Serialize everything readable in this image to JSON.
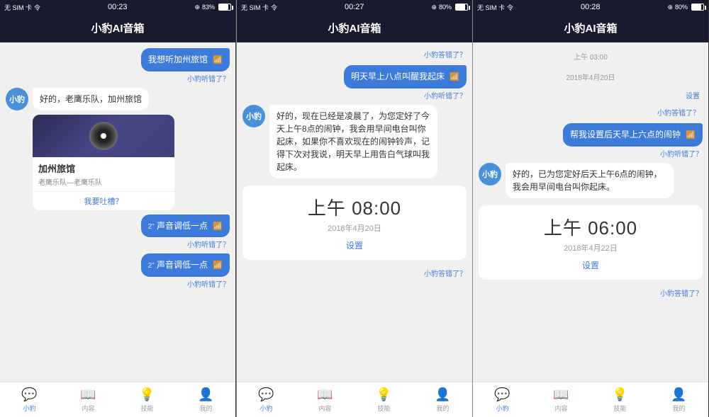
{
  "panels": [
    {
      "id": "panel1",
      "status": {
        "left": "无 SIM 卡 令",
        "time": "00:23",
        "right_signal": "⊕ 83%"
      },
      "title": "小豹AI音箱",
      "messages": [
        {
          "type": "user",
          "text": "我想听加州旅馆",
          "feedback": "小豹听错了？"
        },
        {
          "type": "bot",
          "text": "好的，老鹰乐队，加州旅馆",
          "avatar": "小豹"
        },
        {
          "type": "music_card",
          "title": "加州旅馆",
          "artist": "老鹰乐队—老鹰乐队",
          "link": "我要吐槽？"
        },
        {
          "type": "user",
          "prefix": "2\"",
          "text": "声音调低一点",
          "feedback": "小豹听错了？"
        },
        {
          "type": "user",
          "prefix": "2\"",
          "text": "声音调低一点",
          "feedback": "小豹听错了？"
        }
      ],
      "nav": [
        "小豹",
        "内容",
        "技能",
        "我的"
      ]
    },
    {
      "id": "panel2",
      "status": {
        "left": "无 SIM 卡 令",
        "time": "00:27",
        "right_signal": "⊕ 80%"
      },
      "title": "小豹AI音箱",
      "messages": [
        {
          "type": "feedback_only",
          "text": "小豹答错了？"
        },
        {
          "type": "user",
          "text": "明天早上八点叫醒我起床",
          "feedback": "小豹听错了？"
        },
        {
          "type": "bot",
          "text": "好的，现在已经是凌晨了，为您定好了今天上午8点的闹钟，我会用早间电台叫你起床，如果你不喜欢现在的闹钟铃声，记得下次对我说，明天早上用告白气球叫我起床。",
          "avatar": "小豹"
        },
        {
          "type": "clock",
          "time": "上午 08:00",
          "date": "2018年4月20日",
          "action": "设置",
          "feedback": "小豹答错了？"
        }
      ],
      "nav": [
        "小豹",
        "内容",
        "技能",
        "我的"
      ]
    },
    {
      "id": "panel3",
      "status": {
        "left": "无 SIM 卡 令",
        "time": "00:28",
        "right_signal": "⊕ 80%"
      },
      "title": "小豹AI音箱",
      "messages": [
        {
          "type": "date_header",
          "text": "上午 03:00"
        },
        {
          "type": "date_label",
          "text": "2018年4月20日"
        },
        {
          "type": "feedback_only",
          "text": "设置",
          "is_action": true
        },
        {
          "type": "feedback_only",
          "text": "小豹答错了？"
        },
        {
          "type": "user",
          "text": "帮我设置后天早上六点的闹钟",
          "feedback": "小豹听错了？"
        },
        {
          "type": "bot",
          "text": "好的，已为您定好后天上午6点的闹钟，我会用早间电台叫你起床。",
          "avatar": "小豹"
        },
        {
          "type": "clock",
          "time": "上午 06:00",
          "date": "2018年4月22日",
          "action": "设置",
          "feedback": "小豹答错了？"
        }
      ],
      "nav": [
        "小豹",
        "内容",
        "技能",
        "我的"
      ]
    }
  ]
}
